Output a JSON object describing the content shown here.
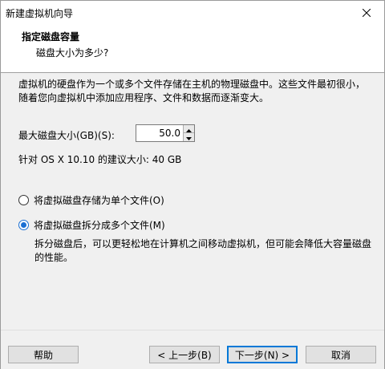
{
  "window": {
    "title": "新建虚拟机向导",
    "close_icon": "close-icon"
  },
  "header": {
    "title": "指定磁盘容量",
    "subtitle": "磁盘大小为多少?"
  },
  "main": {
    "description": "虚拟机的硬盘作为一个或多个文件存储在主机的物理磁盘中。这些文件最初很小，随着您向虚拟机中添加应用程序、文件和数据而逐渐变大。",
    "max_size_label": "最大磁盘大小(GB)(S):",
    "max_size_value": "50.0",
    "recommendation": "针对 OS X 10.10 的建议大小: 40 GB",
    "options": [
      {
        "label": "将虚拟磁盘存储为单个文件(O)",
        "checked": false
      },
      {
        "label": "将虚拟磁盘拆分成多个文件(M)",
        "checked": true
      }
    ],
    "split_description": "拆分磁盘后，可以更轻松地在计算机之间移动虚拟机，但可能会降低大容量磁盘的性能。"
  },
  "footer": {
    "help": "帮助",
    "back": "< 上一步(B)",
    "next": "下一步(N) >",
    "cancel": "取消"
  },
  "colors": {
    "accent": "#0078d7",
    "radio_selected": "#1a6fd3"
  }
}
